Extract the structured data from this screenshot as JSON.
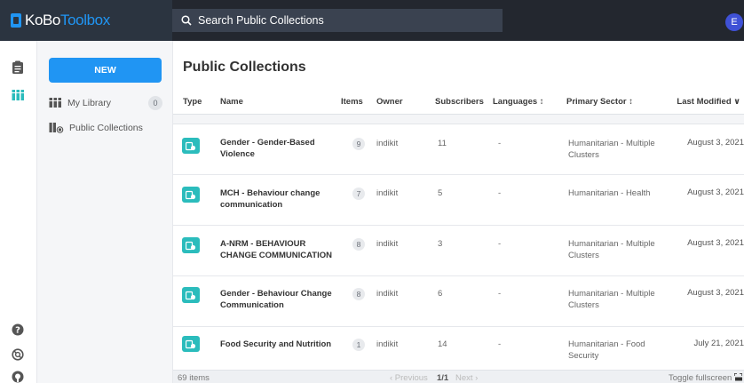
{
  "brand": {
    "kobo": "KoBo",
    "toolbox": "Toolbox"
  },
  "search": {
    "placeholder": "Search Public Collections"
  },
  "user": {
    "initial": "E"
  },
  "sidebar": {
    "new_label": "NEW",
    "items": [
      {
        "label": "My Library",
        "count": "0",
        "icon": "library-icon"
      },
      {
        "label": "Public Collections",
        "icon": "public-collections-icon"
      }
    ]
  },
  "main": {
    "title": "Public Collections",
    "columns": {
      "type": "Type",
      "name": "Name",
      "items": "Items",
      "owner": "Owner",
      "subscribers": "Subscribers",
      "languages": "Languages ↕",
      "sector": "Primary Sector ↕",
      "modified": "Last Modified ∨"
    },
    "rows": [
      {
        "name": "Gender - Gender-Based Violence",
        "items": "9",
        "owner": "indikit",
        "subscribers": "11",
        "languages": "-",
        "sector": "Humanitarian - Multiple Clusters",
        "modified": "August 3, 2021"
      },
      {
        "name": "MCH - Behaviour change communication",
        "items": "7",
        "owner": "indikit",
        "subscribers": "5",
        "languages": "-",
        "sector": "Humanitarian - Health",
        "modified": "August 3, 2021"
      },
      {
        "name": "A-NRM - BEHAVIOUR CHANGE COMMUNICATION",
        "items": "8",
        "owner": "indikit",
        "subscribers": "3",
        "languages": "-",
        "sector": "Humanitarian - Multiple Clusters",
        "modified": "August 3, 2021"
      },
      {
        "name": "Gender - Behaviour Change Communication",
        "items": "8",
        "owner": "indikit",
        "subscribers": "6",
        "languages": "-",
        "sector": "Humanitarian - Multiple Clusters",
        "modified": "August 3, 2021"
      },
      {
        "name": "Food Security and Nutrition",
        "items": "1",
        "owner": "indikit",
        "subscribers": "14",
        "languages": "-",
        "sector": "Humanitarian - Food Security",
        "modified": "July 21, 2021"
      }
    ]
  },
  "footer": {
    "count": "69 items",
    "previous": "‹ Previous",
    "page": "1/1",
    "next": "Next ›",
    "fullscreen": "Toggle fullscreen"
  },
  "colors": {
    "accent": "#2095f3",
    "topbar": "#23272f",
    "collection_icon": "#2bbcbc"
  }
}
